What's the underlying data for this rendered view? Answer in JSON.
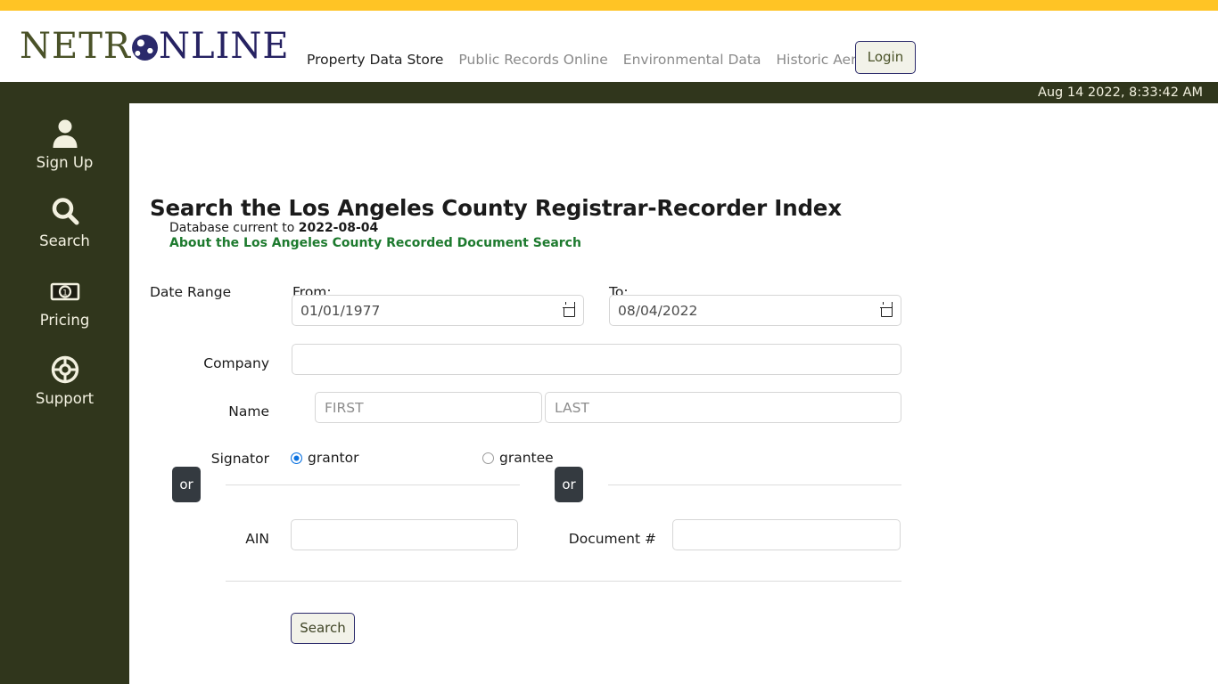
{
  "top_strip": {
    "color": "#ffc425"
  },
  "brand": {
    "logo_first": "NETR",
    "logo_globe": "globe-icon",
    "logo_last": "NLINE",
    "colors": {
      "green": "#4a5228",
      "navy": "#262262"
    }
  },
  "nav": {
    "items": [
      {
        "label": "Property Data Store",
        "active": true
      },
      {
        "label": "Public Records Online",
        "active": false
      },
      {
        "label": "Environmental Data",
        "active": false
      },
      {
        "label": "Historic Aerials",
        "active": false
      }
    ],
    "login_label": "Login"
  },
  "date_bar": {
    "timestamp": "Aug 14 2022, 8:33:42 AM",
    "bg": "#30361c"
  },
  "sidebar": {
    "bg": "#30361c",
    "items": [
      {
        "label": "Sign Up",
        "icon": "user-icon"
      },
      {
        "label": "Search",
        "icon": "magnifier-icon"
      },
      {
        "label": "Pricing",
        "icon": "banknote-icon"
      },
      {
        "label": "Support",
        "icon": "lifebuoy-icon"
      }
    ]
  },
  "main": {
    "title": "Search the Los Angeles County Registrar-Recorder Index",
    "database_current_lead": "Database current to ",
    "database_current_date": "2022-08-04",
    "about_link": "About the Los Angeles County Recorded Document Search",
    "form": {
      "date_range_label": "Date Range",
      "from_label": "From:",
      "from_value": "01/01/1977",
      "to_label": "To:",
      "to_value": "08/04/2022",
      "company_label": "Company",
      "company_value": "",
      "company_placeholder": "",
      "name_label": "Name",
      "first_placeholder": "FIRST",
      "first_value": "",
      "last_placeholder": "LAST",
      "last_value": "",
      "signator_label": "Signator",
      "grantor_label": "grantor",
      "grantee_label": "grantee",
      "grantor_selected": true,
      "or_badge_1": "or",
      "or_badge_2": "or",
      "ain_label": "AIN",
      "ain_value": "",
      "ain_placeholder": "",
      "document_label": "Document #",
      "document_value": "",
      "document_placeholder": "",
      "search_button": "Search"
    }
  }
}
